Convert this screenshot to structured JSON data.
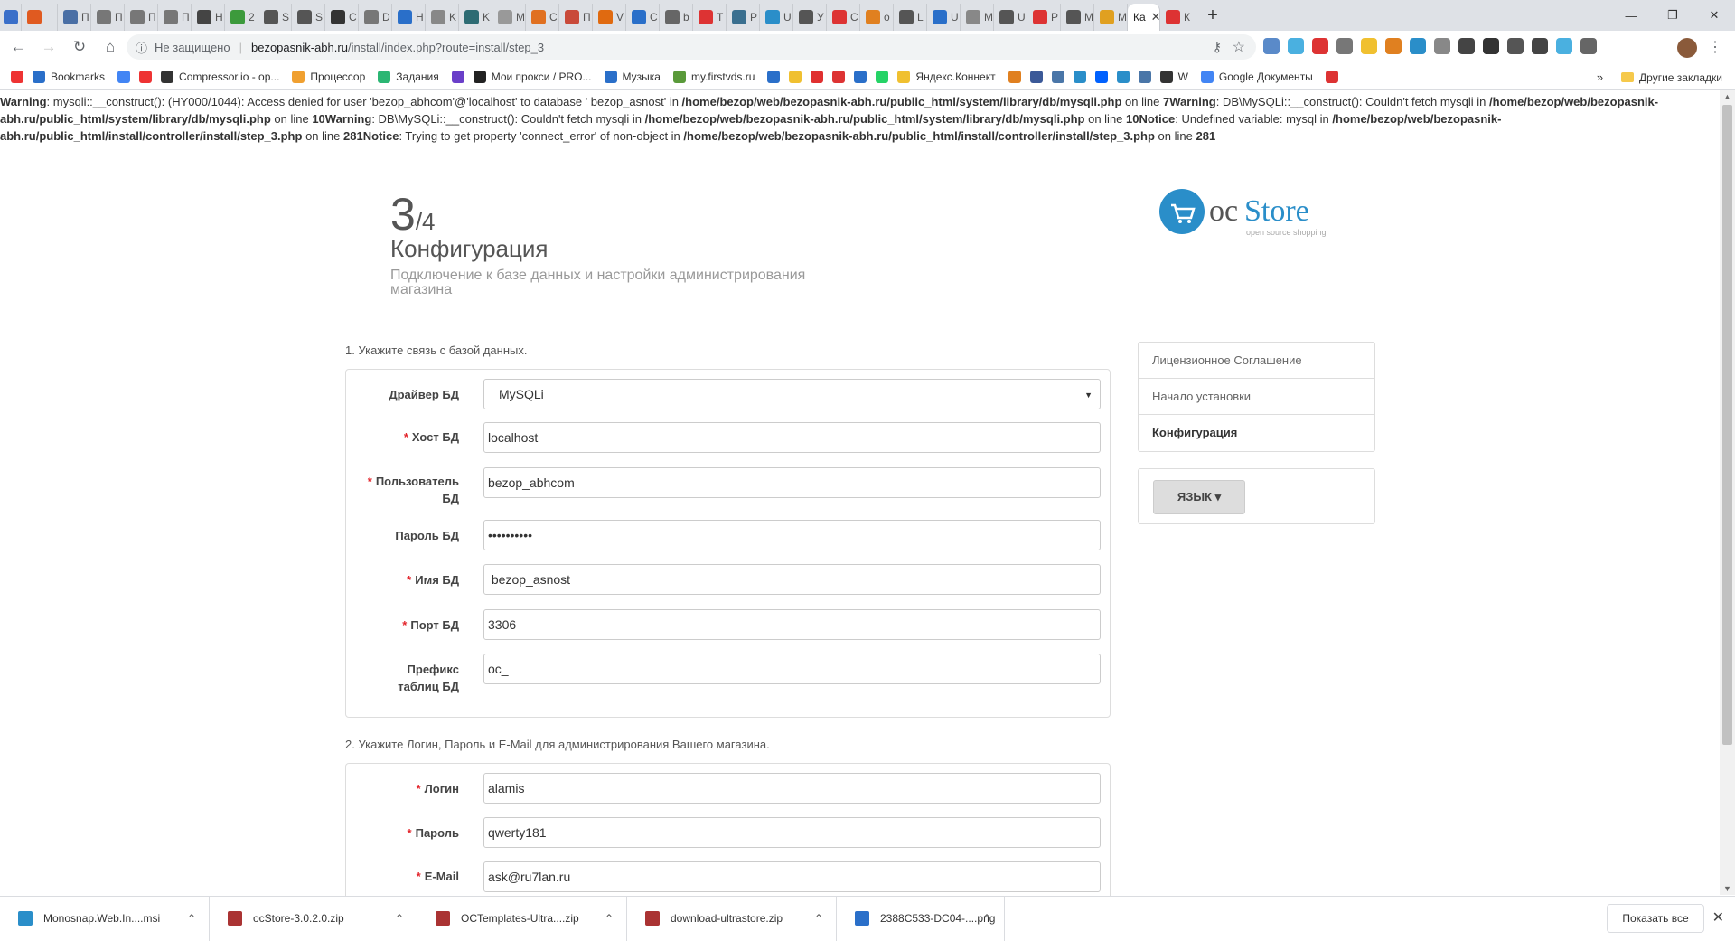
{
  "browser": {
    "tabs": [
      {
        "label": "П",
        "color": "#4a6fa5"
      },
      {
        "label": "П",
        "color": "#777"
      },
      {
        "label": "П",
        "color": "#777"
      },
      {
        "label": "П",
        "color": "#777"
      },
      {
        "label": "Н",
        "color": "#444"
      },
      {
        "label": "2",
        "color": "#3c9a3c"
      },
      {
        "label": "S",
        "color": "#555"
      },
      {
        "label": "S",
        "color": "#555"
      },
      {
        "label": "С",
        "color": "#333"
      },
      {
        "label": "D",
        "color": "#777"
      },
      {
        "label": "Н",
        "color": "#2a6fc9"
      },
      {
        "label": "K",
        "color": "#888"
      },
      {
        "label": "K",
        "color": "#2d6b73"
      },
      {
        "label": "М",
        "color": "#999"
      },
      {
        "label": "С",
        "color": "#e07020"
      },
      {
        "label": "П",
        "color": "#c94a3a"
      },
      {
        "label": "V",
        "color": "#e06a10"
      },
      {
        "label": "С",
        "color": "#2a6fc9"
      },
      {
        "label": "b",
        "color": "#666"
      },
      {
        "label": "Т",
        "color": "#d33"
      },
      {
        "label": "Р",
        "color": "#3a6f8f"
      },
      {
        "label": "U",
        "color": "#2a8ec9"
      },
      {
        "label": "У",
        "color": "#555"
      },
      {
        "label": "С",
        "color": "#d33"
      },
      {
        "label": "о",
        "color": "#e08020"
      },
      {
        "label": "L",
        "color": "#555"
      },
      {
        "label": "U",
        "color": "#2a6fc9"
      },
      {
        "label": "М",
        "color": "#888"
      },
      {
        "label": "U",
        "color": "#555"
      },
      {
        "label": "Р",
        "color": "#d33"
      },
      {
        "label": "М",
        "color": "#555"
      },
      {
        "label": "М",
        "color": "#e0a020"
      }
    ],
    "active_tab": {
      "label": "Ка",
      "close": "✕"
    },
    "after_tab": {
      "label": "К"
    },
    "new_tab": "+",
    "window_controls": [
      "—",
      "❐",
      "✕"
    ],
    "address": {
      "security": "Не защищено",
      "host": "bezopasnik-abh.ru",
      "path": "/install/index.php?route=install/step_3"
    },
    "bookmarks": [
      {
        "label": "",
        "color": "#e33"
      },
      {
        "label": "Bookmarks",
        "color": "#2a6fc9"
      },
      {
        "label": "",
        "color": "#4285f4"
      },
      {
        "label": "",
        "color": "#e33"
      },
      {
        "label": "Compressor.io - op...",
        "color": "#333"
      },
      {
        "label": "Процессор",
        "color": "#f0a030"
      },
      {
        "label": "Задания",
        "color": "#2bb673"
      },
      {
        "label": "",
        "color": "#6a3fc9"
      },
      {
        "label": "Мои прокси / PRO...",
        "color": "#222"
      },
      {
        "label": "Музыка",
        "color": "#2a6fc9"
      },
      {
        "label": "my.firstvds.ru",
        "color": "#5a9a3a"
      },
      {
        "label": "",
        "color": "#2a6fc9"
      },
      {
        "label": "",
        "color": "#f0c030"
      },
      {
        "label": "",
        "color": "#e03030"
      },
      {
        "label": "",
        "color": "#d33"
      },
      {
        "label": "",
        "color": "#2a6fc9"
      },
      {
        "label": "",
        "color": "#25d366"
      },
      {
        "label": "Яндекс.Коннект",
        "color": "#f0c030"
      },
      {
        "label": "",
        "color": "#e08020"
      },
      {
        "label": "",
        "color": "#3b5998"
      },
      {
        "label": "",
        "color": "#4a76a8"
      },
      {
        "label": "",
        "color": "#2a8ec9"
      },
      {
        "label": "",
        "color": "#0061fe"
      },
      {
        "label": "",
        "color": "#2a8ec9"
      },
      {
        "label": "",
        "color": "#4a76a8"
      },
      {
        "label": "W",
        "color": "#333"
      },
      {
        "label": "Google Документы",
        "color": "#4285f4"
      },
      {
        "label": "",
        "color": "#d33"
      }
    ],
    "bookmarks_more": "»",
    "other_bookmarks": "Другие закладки"
  },
  "warning": {
    "parts": [
      {
        "b": "Warning",
        "t": ": mysqli::__construct(): (HY000/1044): Access denied for user 'bezop_abhcom'@'localhost' to database ' bezop_asnost' in "
      },
      {
        "b": "/home/bezop/web/bezopasnik-abh.ru/public_html/system/library/db/mysqli.php",
        "t": " on line "
      },
      {
        "b": "7",
        "t": ""
      },
      {
        "b": "Warning",
        "t": ": DB\\MySQLi::__construct(): Couldn't fetch mysqli in "
      },
      {
        "b": "/home/bezop/web/bezopasnik-abh.ru/public_html/system/library/db/mysqli.php",
        "t": " on line "
      },
      {
        "b": "10",
        "t": ""
      },
      {
        "b": "Warning",
        "t": ": DB\\MySQLi::__construct(): Couldn't fetch mysqli in "
      },
      {
        "b": "/home/bezop/web/bezopasnik-abh.ru/public_html/system/library/db/mysqli.php",
        "t": " on line "
      },
      {
        "b": "10",
        "t": ""
      },
      {
        "b": "Notice",
        "t": ": Undefined variable: mysql in "
      },
      {
        "b": "/home/bezop/web/bezopasnik-abh.ru/public_html/install/controller/install/step_3.php",
        "t": " on line "
      },
      {
        "b": "281",
        "t": ""
      },
      {
        "b": "Notice",
        "t": ": Trying to get property 'connect_error' of non-object in "
      },
      {
        "b": "/home/bezop/web/bezopasnik-abh.ru/public_html/install/controller/install/step_3.php",
        "t": " on line "
      },
      {
        "b": "281",
        "t": ""
      }
    ]
  },
  "header": {
    "step_current": "3",
    "step_total": "/4",
    "title": "Конфигурация",
    "subtitle": "Подключение к базе данных и настройки администрирования магазина"
  },
  "logo": {
    "oc": "oc",
    "store": "Store",
    "tagline": "open source shopping"
  },
  "db_section": {
    "heading": "1. Укажите связь с базой данных.",
    "driver": {
      "label": "Драйвер БД",
      "value": "MySQLi"
    },
    "host": {
      "label": "Хост БД",
      "value": "localhost"
    },
    "user": {
      "label": "Пользователь БД",
      "value": "bezop_abhcom"
    },
    "password": {
      "label": "Пароль БД",
      "value": "••••••••••"
    },
    "dbname": {
      "label": "Имя БД",
      "value": " bezop_asnost"
    },
    "port": {
      "label": "Порт БД",
      "value": "3306"
    },
    "prefix": {
      "label": "Префикс таблиц БД",
      "value": "oc_"
    }
  },
  "admin_section": {
    "heading": "2. Укажите Логин, Пароль и E-Mail для администрирования Вашего магазина.",
    "login": {
      "label": "Логин",
      "value": "alamis"
    },
    "password": {
      "label": "Пароль",
      "value": "qwerty181"
    },
    "email": {
      "label": "E-Mail",
      "value": "ask@ru7lan.ru"
    }
  },
  "required_mark": "*",
  "sidebar": {
    "items": [
      {
        "label": "Лицензионное Соглашение"
      },
      {
        "label": "Начало установки"
      },
      {
        "label": "Конфигурация"
      }
    ],
    "language_button": "ЯЗЫК ▾"
  },
  "downloads": {
    "items": [
      {
        "label": "Monosnap.Web.In....msi",
        "color": "#2a8ec9"
      },
      {
        "label": "ocStore-3.0.2.0.zip",
        "color": "#a33"
      },
      {
        "label": "OCTemplates-Ultra....zip",
        "color": "#a33"
      },
      {
        "label": "download-ultrastore.zip",
        "color": "#a33"
      },
      {
        "label": "2388C533-DC04-....png",
        "color": "#2a6fc9"
      }
    ],
    "show_all": "Показать все",
    "close": "✕"
  }
}
